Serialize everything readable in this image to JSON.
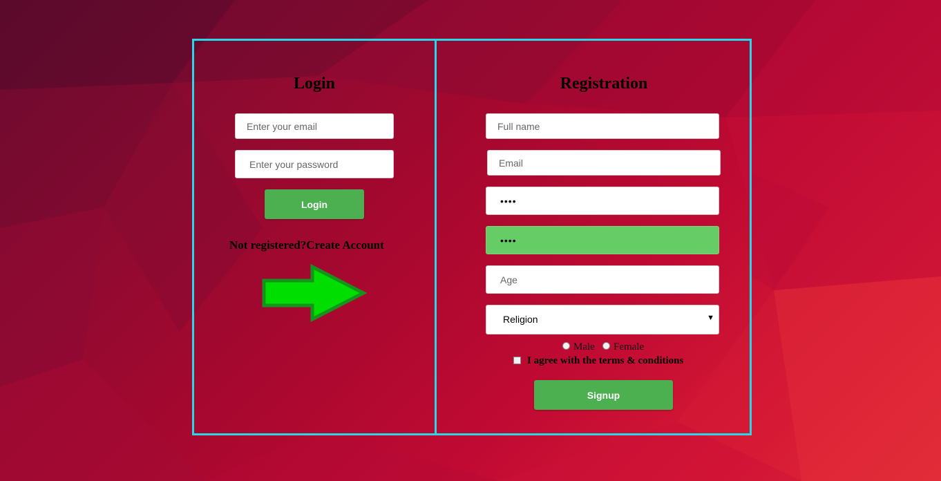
{
  "login": {
    "title": "Login",
    "email_placeholder": "Enter your email",
    "password_placeholder": "Enter your password",
    "button_label": "Login",
    "not_registered_text": "Not registered?",
    "create_account_link": "Create Account"
  },
  "registration": {
    "title": "Registration",
    "fullname_placeholder": "Full name",
    "email_placeholder": "Email",
    "password_value": "••••",
    "confirm_password_value": "••••",
    "age_placeholder": "Age",
    "religion_selected": "Religion",
    "gender_options": [
      "Male",
      "Female"
    ],
    "terms_label": "I agree with the terms & conditions",
    "button_label": "Signup"
  },
  "decor": {
    "arrow_icon": "right-arrow-icon",
    "arrow_color": "#00dd00",
    "panel_border_color": "#28d8e8",
    "button_color": "#4caf50",
    "confirm_field_color": "#66cc66"
  }
}
